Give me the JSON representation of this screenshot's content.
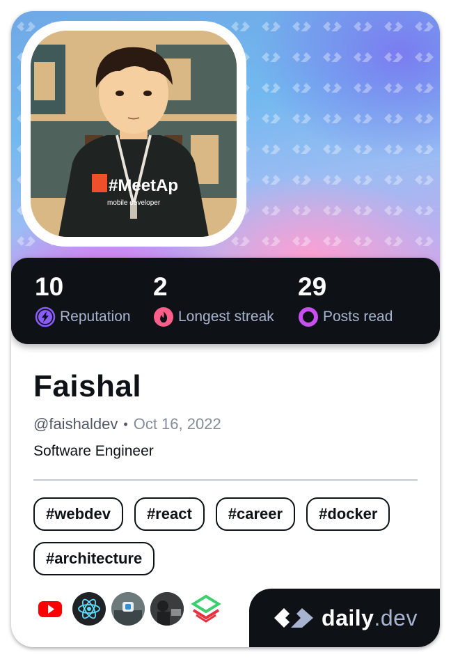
{
  "profile": {
    "name": "Faishal",
    "handle": "@faishaldev",
    "separator": "•",
    "joined": "Oct 16, 2022",
    "bio": "Software Engineer"
  },
  "stats": [
    {
      "value": "10",
      "label": "Reputation",
      "icon": "lightning-icon",
      "color": "#8a5cf6"
    },
    {
      "value": "2",
      "label": "Longest streak",
      "icon": "flame-icon",
      "color": "#ff5e8a"
    },
    {
      "value": "29",
      "label": "Posts read",
      "icon": "ring-icon",
      "color": "#c84ef0"
    }
  ],
  "tags": [
    "#webdev",
    "#react",
    "#career",
    "#docker",
    "#architecture"
  ],
  "stack": [
    "youtube-icon",
    "react-icon",
    "source-avatar-1",
    "source-avatar-2",
    "layered-logo-icon"
  ],
  "avatar_shirt_text": {
    "main": "#MeetAp",
    "sub": "mobile developer"
  },
  "brand": {
    "name": "daily",
    "tld": ".dev"
  },
  "colors": {
    "dark": "#0e1217",
    "label": "#a8b3cf",
    "youtube": "#ff0000",
    "react": "#61dafb"
  }
}
